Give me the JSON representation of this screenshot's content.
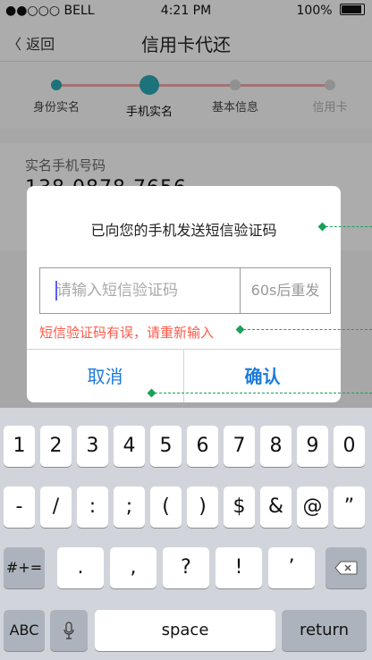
{
  "statusbar": {
    "carrier": "●●○○○ BELL",
    "time": "4:21 PM",
    "battery": "100%"
  },
  "navbar": {
    "back": "〈 返回",
    "title": "信用卡代还"
  },
  "steps": [
    {
      "label": "身份实名",
      "state": "done"
    },
    {
      "label": "手机实名",
      "state": "current"
    },
    {
      "label": "基本信息",
      "state": "todo"
    },
    {
      "label": "信用卡",
      "state": "todo"
    }
  ],
  "phone": {
    "label": "实名手机号码",
    "value": "138 0878 7656"
  },
  "dialog": {
    "message": "已向您的手机发送短信验证码",
    "code_placeholder": "请输入短信验证码",
    "resend": "60s后重发",
    "error": "短信验证码有误，请重新输入",
    "cancel": "取消",
    "confirm": "确认"
  },
  "keyboard": {
    "row1": [
      "1",
      "2",
      "3",
      "4",
      "5",
      "6",
      "7",
      "8",
      "9",
      "0"
    ],
    "row2": [
      "-",
      "/",
      ":",
      ";",
      "(",
      ")",
      "$",
      "&",
      "@",
      "”"
    ],
    "row3_mode": "#+=",
    "row3": [
      ".",
      ",",
      "?",
      "!",
      "’"
    ],
    "abc": "ABC",
    "space": "space",
    "return": "return"
  },
  "colors": {
    "accent": "#1c7bd8",
    "error": "#ff5a4a",
    "step": "#2aa4b0"
  }
}
